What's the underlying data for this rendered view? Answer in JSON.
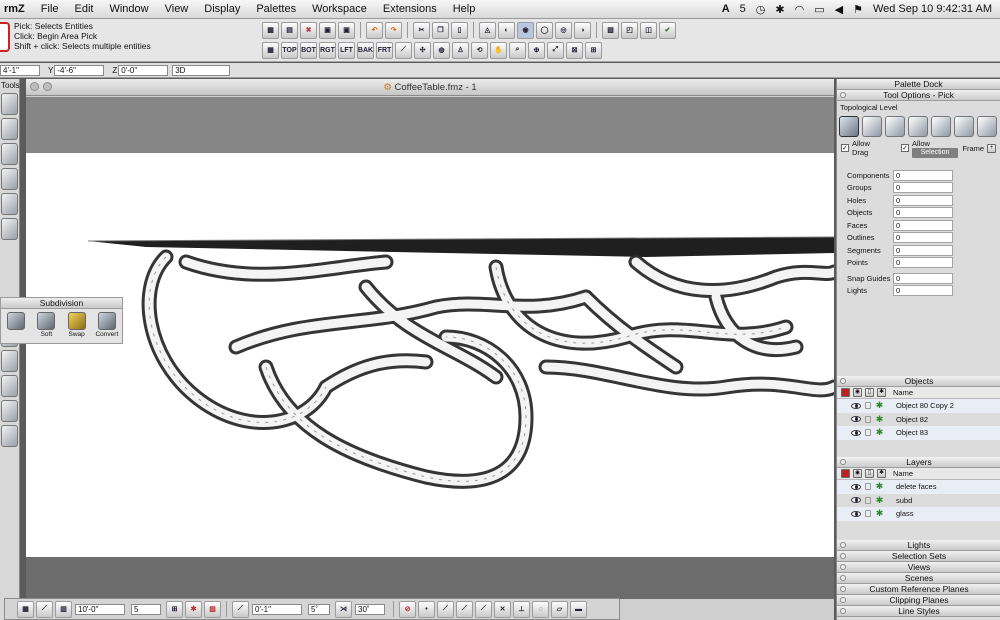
{
  "menubar": {
    "app": "rmZ",
    "items": [
      "File",
      "Edit",
      "Window",
      "View",
      "Display",
      "Palettes",
      "Workspace",
      "Extensions",
      "Help"
    ],
    "clock": "Wed Sep 10  9:42:31 AM",
    "adobe_badge": "5"
  },
  "pick_info": {
    "line1": "Pick:   Selects Entities",
    "line2": "Click: Begin Area Pick",
    "line3": "Shift + click: Selects multiple entities"
  },
  "toolbar_row2_labels": [
    "TOP",
    "BOT",
    "RGT",
    "LFT",
    "BAK",
    "FRT"
  ],
  "coords": {
    "x_label": "",
    "x_value": "4'-1\"",
    "y_label": "Y",
    "y_value": "-4'-6\"",
    "z_label": "Z",
    "z_value": "0'-0\"",
    "mode": "3D"
  },
  "left_tools": {
    "label": "Tools"
  },
  "document": {
    "title": "CoffeeTable.fmz - 1"
  },
  "subdivision_palette": {
    "title": "Subdivision",
    "tools": [
      "",
      "Soft",
      "Swap",
      "Convert"
    ]
  },
  "bottom_toolbar": {
    "field1": "10'-0\"",
    "field2": "5",
    "field3": "0'-1\"",
    "field4": "5˚",
    "field5": "30˚"
  },
  "dock": {
    "title": "Palette Dock",
    "tool_options_title": "Tool Options - Pick",
    "topological_level": "Topological Level",
    "allow_drag": "Allow Drag",
    "allow_copy": "Allow Copy",
    "frame": "Frame",
    "tooltip": "Selection",
    "stats": [
      {
        "k": "Components",
        "v": "0"
      },
      {
        "k": "Groups",
        "v": "0"
      },
      {
        "k": "Holes",
        "v": "0"
      },
      {
        "k": "Objects",
        "v": "0"
      },
      {
        "k": "Faces",
        "v": "0"
      },
      {
        "k": "Outlines",
        "v": "0"
      },
      {
        "k": "Segments",
        "v": "0"
      },
      {
        "k": "Points",
        "v": "0"
      }
    ],
    "stats2": [
      {
        "k": "Snap Guides",
        "v": "0"
      },
      {
        "k": "Lights",
        "v": "0"
      }
    ],
    "objects_title": "Objects",
    "name_header": "Name",
    "objects": [
      "Object 80 Copy 2",
      "Object 82",
      "Object 83"
    ],
    "layers_title": "Layers",
    "layers": [
      "delete faces",
      "subd",
      "glass"
    ],
    "collapsed": [
      "Lights",
      "Selection Sets",
      "Views",
      "Scenes",
      "Custom Reference Planes",
      "Clipping Planes",
      "Line Styles"
    ]
  },
  "colors": {
    "selection_red": "#c22222",
    "viewport_bg": "#ffffff",
    "gray_bg": "#868686"
  }
}
